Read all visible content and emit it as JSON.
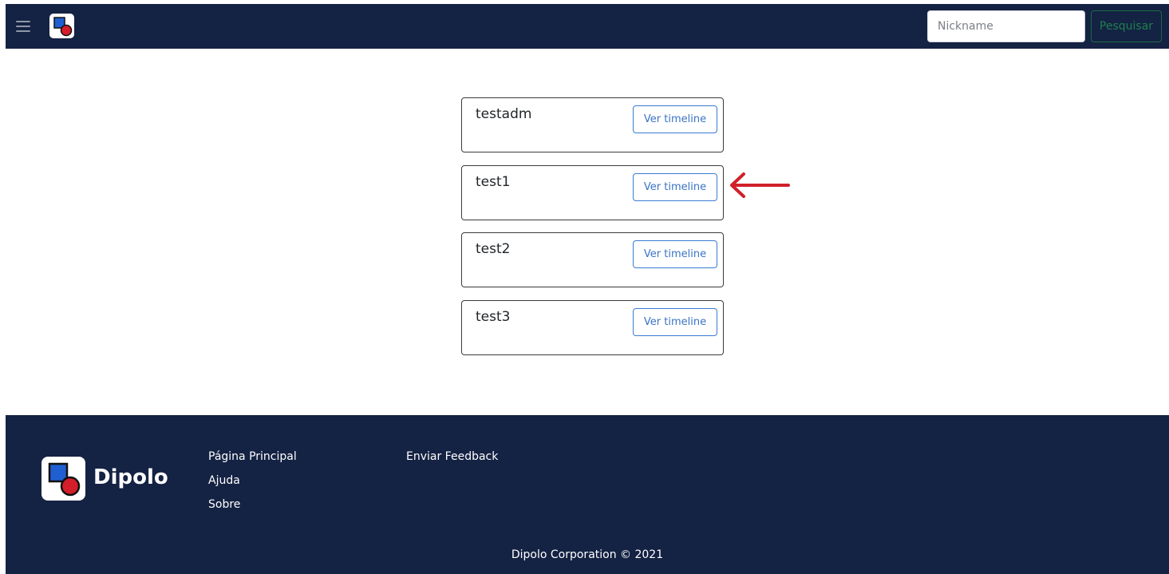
{
  "header": {
    "menu_icon": "hamburger-menu-icon",
    "logo_icon": "dipolo-logo-icon",
    "search": {
      "placeholder": "Nickname",
      "value": "",
      "button_label": "Pesquisar"
    }
  },
  "users": [
    {
      "name": "testadm",
      "button_label": "Ver timeline"
    },
    {
      "name": "test1",
      "button_label": "Ver timeline"
    },
    {
      "name": "test2",
      "button_label": "Ver timeline"
    },
    {
      "name": "test3",
      "button_label": "Ver timeline"
    }
  ],
  "annotation": {
    "arrow_icon": "left-arrow-icon",
    "color": "#d0202a"
  },
  "footer": {
    "brand": "Dipolo",
    "logo_icon": "dipolo-logo-icon",
    "links_col1": [
      "Página Principal",
      "Ajuda",
      "Sobre"
    ],
    "links_col2": [
      "Enviar Feedback"
    ],
    "copyright": "Dipolo Corporation © 2021"
  },
  "colors": {
    "navbar_bg": "#142243",
    "search_button": "#1f7f4e",
    "card_button": "#3a73c4",
    "logo_blue": "#1f5fd1",
    "logo_red": "#d41e2a"
  }
}
